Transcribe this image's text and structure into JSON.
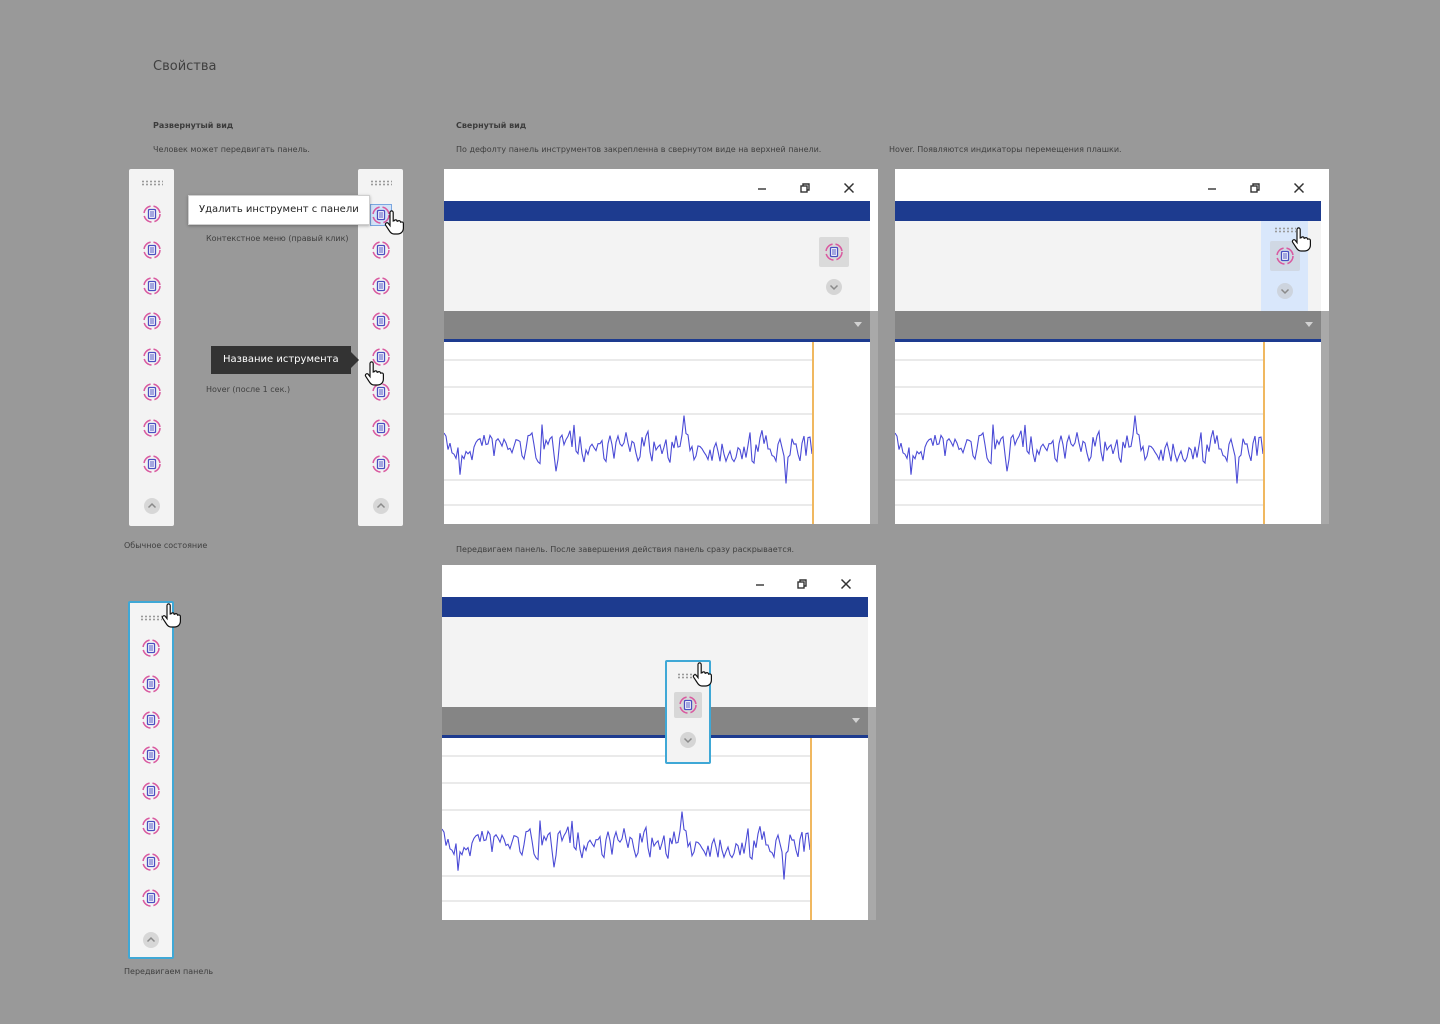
{
  "page": {
    "title": "Свойства"
  },
  "sections": {
    "expanded": {
      "heading": "Развернутый вид",
      "description": "Человек может  передвигать панель.",
      "normal_caption": "Обычное состояние",
      "context_menu_item": "Удалить инструмент с панели",
      "context_menu_caption": "Контекстное меню (правый клик)",
      "tooltip_text": "Название иструмента",
      "tooltip_caption": "Hover (после 1 сек.)",
      "moving_caption": "Передвигаем панель"
    },
    "collapsed": {
      "heading": "Свернутый вид",
      "default_description": "По дефолту панель инструментов закрепленна в свернутом виде на верхней панели.",
      "hover_description": "Hover. Появляются индикаторы перемещения плашки.",
      "drag_description": "Передвигаем панель. После завершения действия  панель сразу раскрывается."
    }
  },
  "icons": {
    "tool": "tool-document-refresh-icon",
    "expand_up": "chevron-up-icon",
    "expand_down": "chevron-down-icon",
    "minimize": "minimize-icon",
    "restore": "restore-icon",
    "close": "close-icon",
    "cursor": "hand-pointer-icon"
  },
  "colors": {
    "background": "#999999",
    "window_bar": "#1d3b8f",
    "signal_line": "#4b4bd6",
    "marker_line": "#f0b860",
    "panel_move_border": "#3fa8d6",
    "hover_zone": "#d9e7fb"
  }
}
